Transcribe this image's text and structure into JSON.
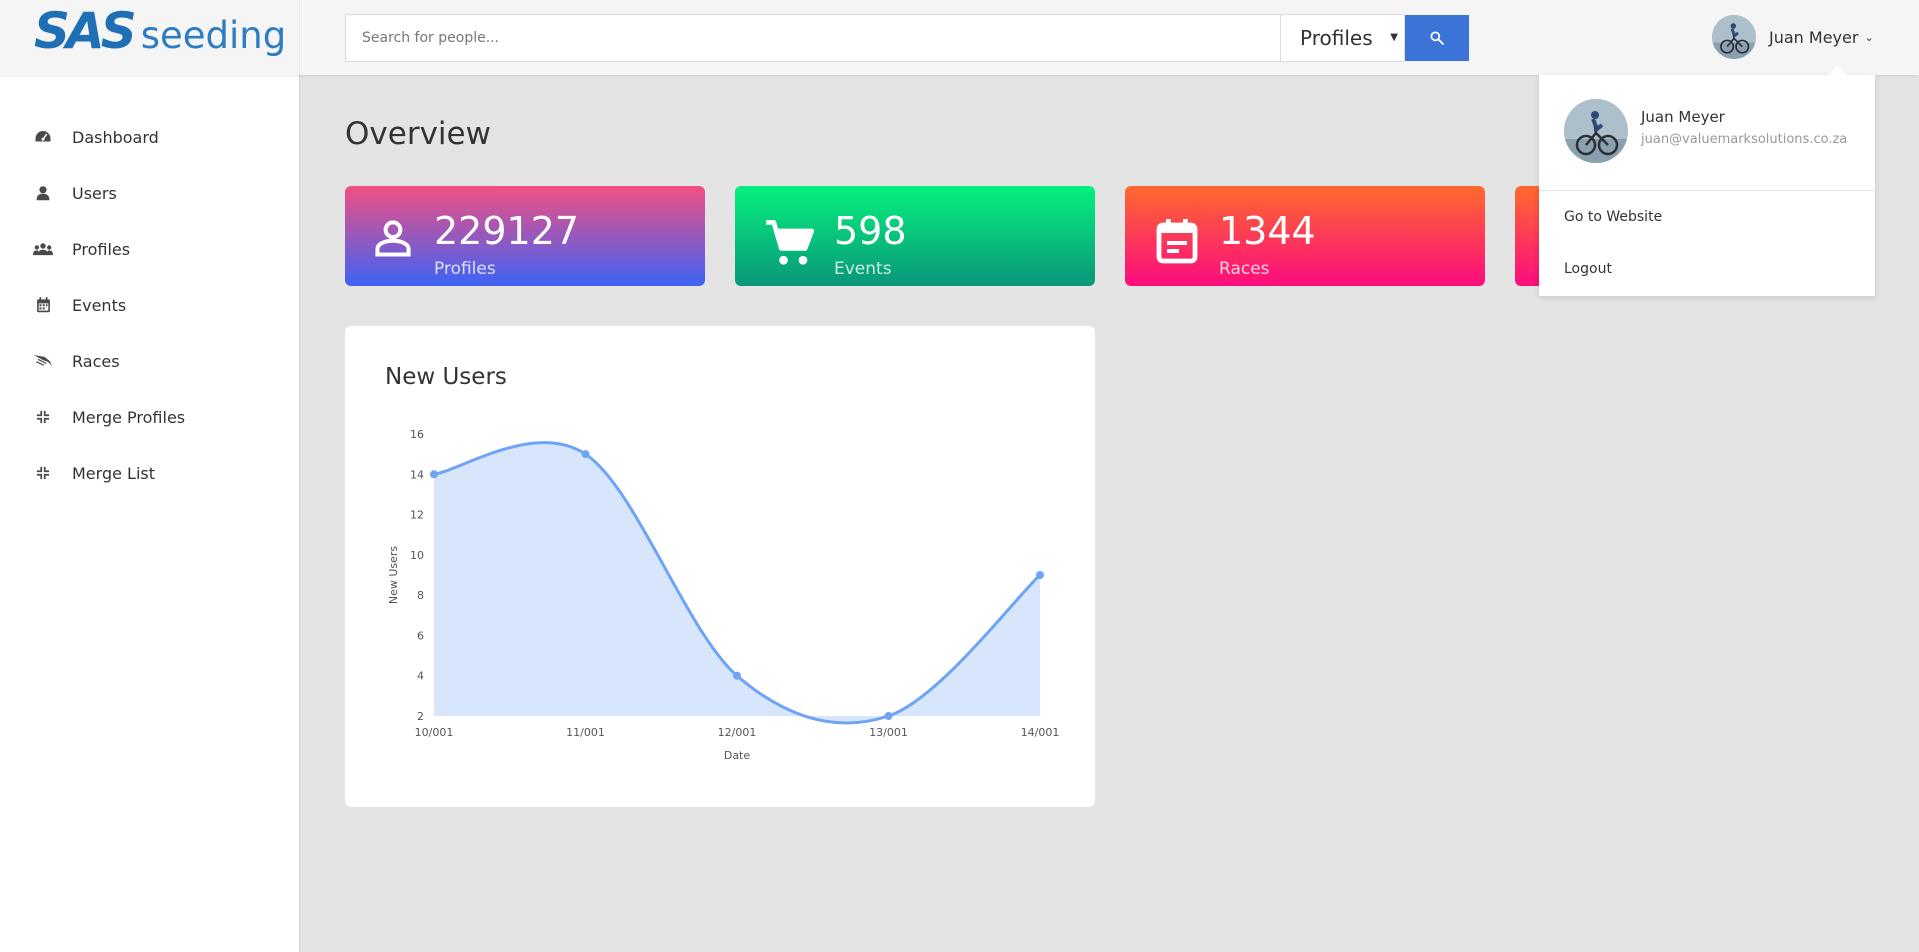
{
  "header": {
    "logo_sas": "SAS",
    "logo_seeding": "seeding",
    "search_placeholder": "Search for people...",
    "search_scope": "Profiles",
    "search_button_icon": "search-icon",
    "user_name": "Juan Meyer"
  },
  "sidebar": {
    "items": [
      {
        "label": "Dashboard",
        "icon": "dashboard-icon"
      },
      {
        "label": "Users",
        "icon": "user-icon"
      },
      {
        "label": "Profiles",
        "icon": "users-icon"
      },
      {
        "label": "Events",
        "icon": "calendar-icon"
      },
      {
        "label": "Races",
        "icon": "flag-icon"
      },
      {
        "label": "Merge Profiles",
        "icon": "merge-icon"
      },
      {
        "label": "Merge List",
        "icon": "merge-icon"
      }
    ]
  },
  "main": {
    "title": "Overview",
    "cards": [
      {
        "value": "229127",
        "label": "Profiles",
        "icon": "person-icon"
      },
      {
        "value": "598",
        "label": "Events",
        "icon": "cart-icon"
      },
      {
        "value": "1344",
        "label": "Races",
        "icon": "event-note-icon"
      }
    ]
  },
  "chart": {
    "title": "New Users"
  },
  "chart_data": {
    "type": "area",
    "title": "New Users",
    "xlabel": "Date",
    "ylabel": "New Users",
    "x": [
      "10/001",
      "11/001",
      "12/001",
      "13/001",
      "14/001"
    ],
    "values": [
      14,
      15,
      4,
      2,
      9
    ],
    "ylim": [
      2,
      16
    ],
    "yticks": [
      2,
      4,
      6,
      8,
      10,
      12,
      14,
      16
    ],
    "grid": false,
    "legend": "none",
    "line_color": "#6ea4f5",
    "fill_color": "#d8e6fb"
  },
  "dropdown": {
    "name": "Juan Meyer",
    "email": "juan@valuemarksolutions.co.za",
    "items": [
      "Go to Website",
      "Logout"
    ]
  },
  "colors": {
    "accent": "#3b74d6",
    "logo": "#1f6fb5"
  }
}
